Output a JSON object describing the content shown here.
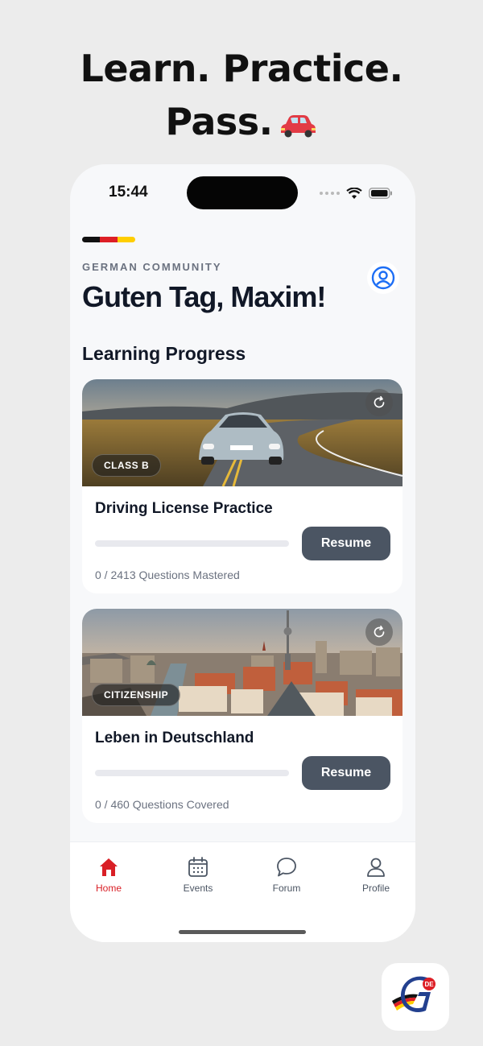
{
  "promo": {
    "line1": "Learn. Practice.",
    "line2": "Pass.",
    "emoji": "car-emoji"
  },
  "status_bar": {
    "time": "15:44"
  },
  "header": {
    "flag_colors": [
      "#111111",
      "#dd1f26",
      "#ffce00"
    ],
    "eyebrow": "GERMAN COMMUNITY",
    "greeting": "Guten Tag, Maxim!",
    "profile_icon": "user-circle-icon"
  },
  "learning_progress": {
    "title": "Learning Progress",
    "cards": [
      {
        "badge": "CLASS B",
        "title": "Driving License Practice",
        "progress": 0,
        "button": "Resume",
        "stat": "0 / 2413 Questions Mastered",
        "image": "sports-car-on-road"
      },
      {
        "badge": "CITIZENSHIP",
        "title": "Leben in Deutschland",
        "progress": 0,
        "button": "Resume",
        "stat": "0 / 460 Questions Covered",
        "image": "berlin-skyline"
      }
    ]
  },
  "tabbar": {
    "items": [
      {
        "label": "Home",
        "icon": "home-icon",
        "active": true
      },
      {
        "label": "Events",
        "icon": "calendar-icon",
        "active": false
      },
      {
        "label": "Forum",
        "icon": "chat-bubble-icon",
        "active": false
      },
      {
        "label": "Profile",
        "icon": "person-icon",
        "active": false
      }
    ]
  },
  "colors": {
    "accent": "#d91f26",
    "button": "#4b5563",
    "profile_blue": "#1d6ef5"
  }
}
